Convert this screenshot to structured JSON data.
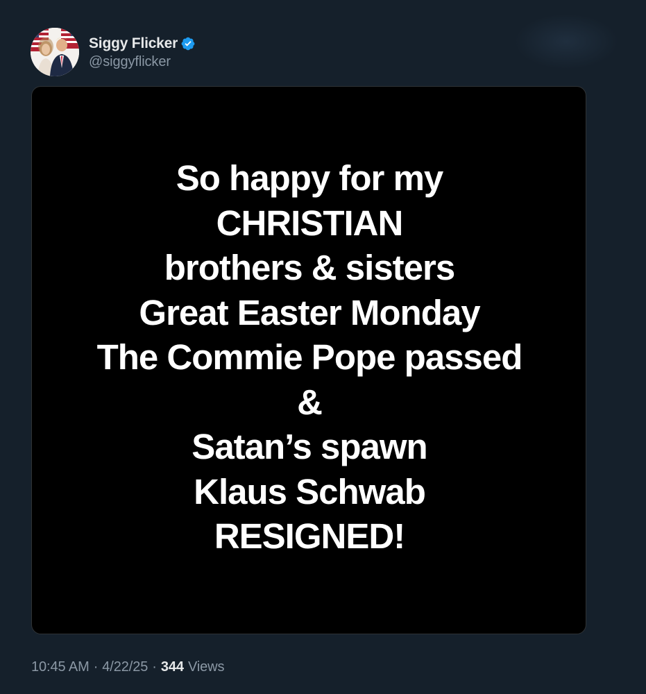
{
  "author": {
    "display_name": "Siggy Flicker",
    "handle": "@siggyflicker",
    "verified_icon": "verified-badge-icon",
    "verified_color": "#1d9bf0"
  },
  "media": {
    "lines": [
      "So happy for my",
      "CHRISTIAN",
      "brothers & sisters",
      "Great Easter Monday",
      "The Commie Pope passed",
      "&",
      "Satan’s spawn",
      "Klaus Schwab",
      "RESIGNED!"
    ]
  },
  "meta": {
    "time": "10:45 AM",
    "separator": "·",
    "date": "4/22/25",
    "views_count": "344",
    "views_label": "Views"
  },
  "colors": {
    "background": "#15202b",
    "text_primary": "#e7e9ea",
    "text_secondary": "#8b98a5",
    "media_background": "#000000"
  }
}
